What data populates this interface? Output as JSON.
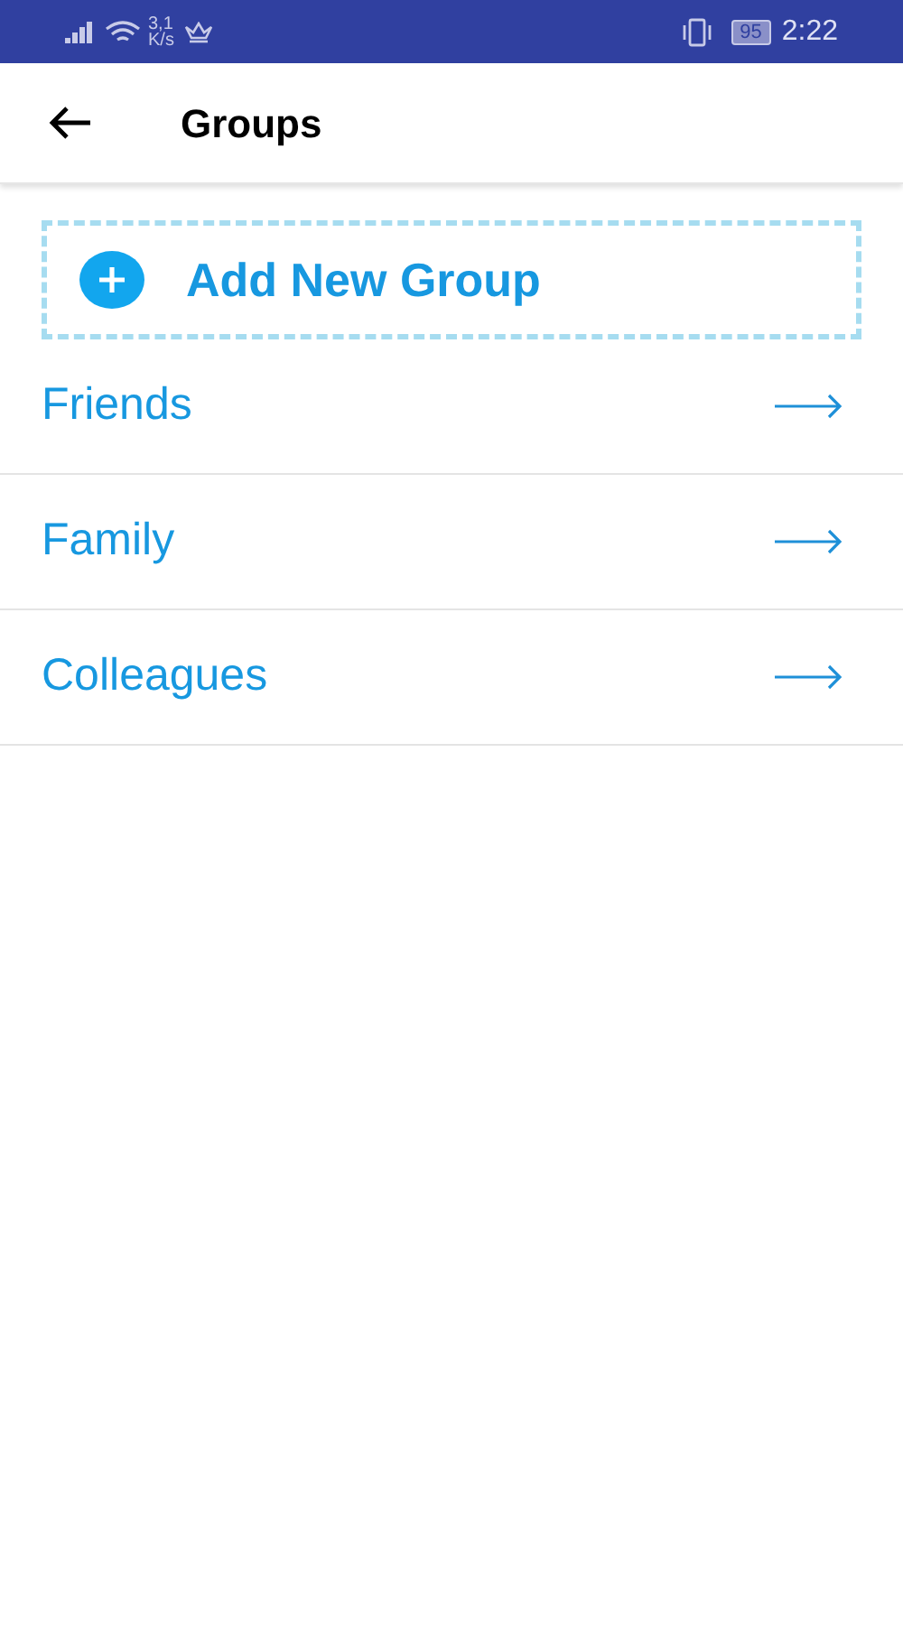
{
  "status_bar": {
    "speed_value": "3,1",
    "speed_unit": "K/s",
    "battery": "95",
    "time": "2:22"
  },
  "app_bar": {
    "title": "Groups"
  },
  "add_button": {
    "label": "Add New Group"
  },
  "groups": [
    {
      "name": "Friends"
    },
    {
      "name": "Family"
    },
    {
      "name": "Colleagues"
    }
  ]
}
